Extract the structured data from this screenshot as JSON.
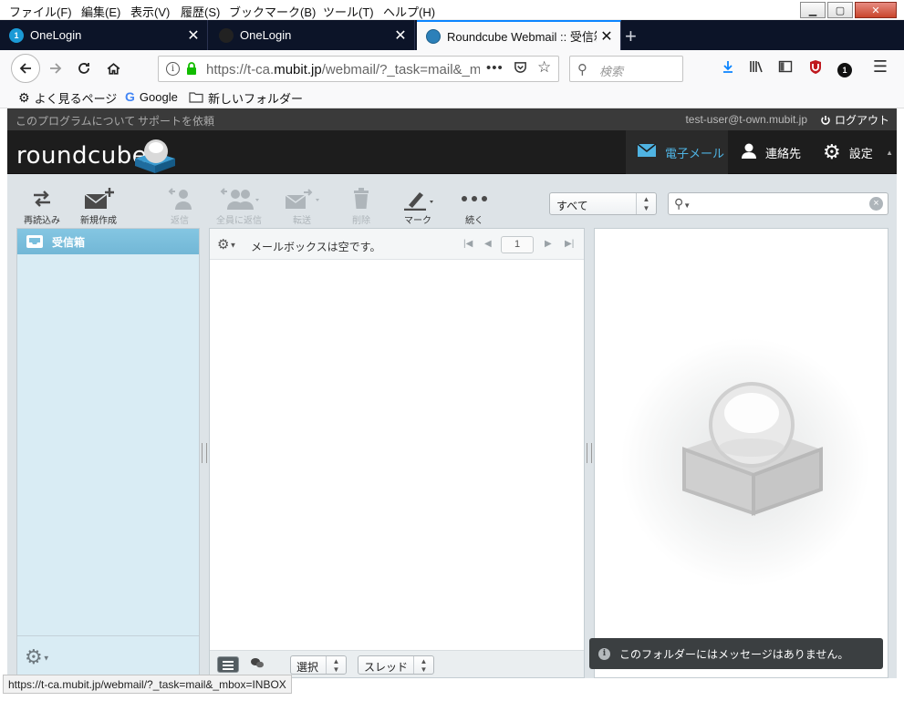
{
  "menubar": {
    "items": [
      "ファイル(F)",
      "編集(E)",
      "表示(V)",
      "履歴(S)",
      "ブックマーク(B)",
      "ツール(T)",
      "ヘルプ(H)"
    ]
  },
  "window_controls": {
    "minimize": "▁",
    "maximize": "▢",
    "close": "✕"
  },
  "tabs": [
    {
      "label": "OneLogin",
      "favicon": "1",
      "active": false
    },
    {
      "label": "OneLogin",
      "favicon": "",
      "active": false
    },
    {
      "label": "Roundcube Webmail :: 受信箱",
      "favicon": "roundcube-icon",
      "active": true
    }
  ],
  "new_tab": "+",
  "navbar": {
    "url_host_prefix": "https://t-ca.",
    "url_host_main": "mubit.jp",
    "url_path": "/webmail/?_task=mail&_mbox=INBOX",
    "search_placeholder": "検索",
    "extension_badge": "1"
  },
  "bookmarks": [
    {
      "label": "よく見るページ",
      "icon": "gear-icon"
    },
    {
      "label": "Google",
      "icon": "google-icon"
    },
    {
      "label": "新しいフォルダー",
      "icon": "folder-icon"
    }
  ],
  "rc_top": {
    "about": "このプログラムについて",
    "support": "サポートを依頼",
    "user": "test-user@t-own.mubit.jp",
    "logout": "ログアウト"
  },
  "rc_header": {
    "logo": "roundcube",
    "nav": [
      {
        "label": "電子メール",
        "icon": "envelope-icon",
        "selected": true
      },
      {
        "label": "連絡先",
        "icon": "person-icon",
        "selected": false
      },
      {
        "label": "設定",
        "icon": "gear-icon",
        "selected": false
      }
    ]
  },
  "toolbar": {
    "refresh": "再読込み",
    "compose": "新規作成",
    "reply": "返信",
    "reply_all": "全員に返信",
    "forward": "転送",
    "delete": "削除",
    "mark": "マーク",
    "more": "続く"
  },
  "filter": {
    "selected": "すべて"
  },
  "folders": {
    "inbox": "受信箱"
  },
  "message_list": {
    "empty_message": "メールボックスは空です。",
    "page": "1",
    "select_label": "選択",
    "threads_label": "スレッド"
  },
  "notice": "このフォルダーにはメッセージはありません。",
  "statusbar": "https://t-ca.mubit.jp/webmail/?_task=mail&_mbox=INBOX",
  "colors": {
    "accent": "#4fb3e2",
    "inbox_bg": "#7abfdd",
    "tab_bar": "#0c1428",
    "header": "#1d1d1d"
  }
}
